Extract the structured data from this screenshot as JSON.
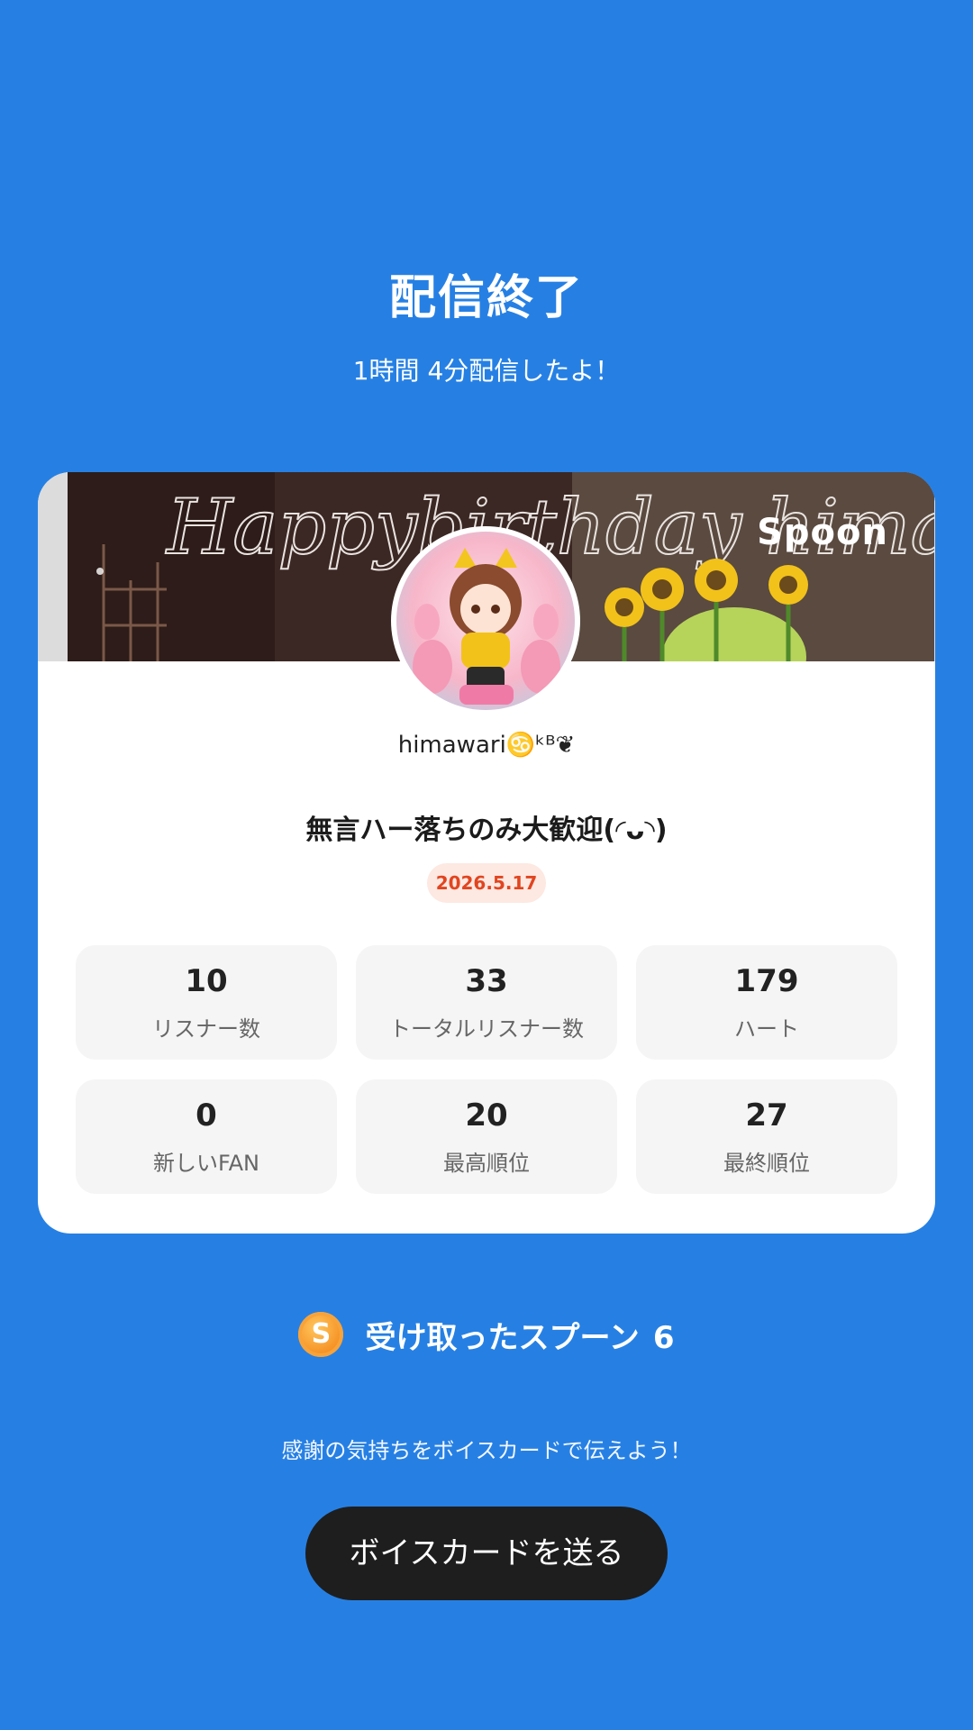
{
  "header": {
    "title": "配信終了",
    "subtitle": "1時間 4分配信したよ！"
  },
  "card": {
    "brand": "Spoon",
    "banner_text": "Happybirthday himawari",
    "username": "himawari♋️ᵏᴮ❦",
    "live_title": "無言ハー落ちのみ大歓迎(◜ᴗ◝)",
    "date": "2026.5.17",
    "stats": [
      {
        "value": "10",
        "label": "リスナー数"
      },
      {
        "value": "33",
        "label": "トータルリスナー数"
      },
      {
        "value": "179",
        "label": "ハート"
      },
      {
        "value": "0",
        "label": "新しいFAN"
      },
      {
        "value": "20",
        "label": "最高順位"
      },
      {
        "value": "27",
        "label": "最終順位"
      }
    ]
  },
  "spoons": {
    "icon": "spoon-coin-icon",
    "icon_letter": "S",
    "label": "受け取ったスプーン",
    "count": "6"
  },
  "footer": {
    "message": "感謝の気持ちをボイスカードで伝えよう！",
    "button_label": "ボイスカードを送る"
  },
  "colors": {
    "background": "#2680E4",
    "card": "#FFFFFF",
    "date_badge_bg": "#FDE8E2",
    "date_badge_text": "#E1451F",
    "button": "#1E1E1E"
  }
}
